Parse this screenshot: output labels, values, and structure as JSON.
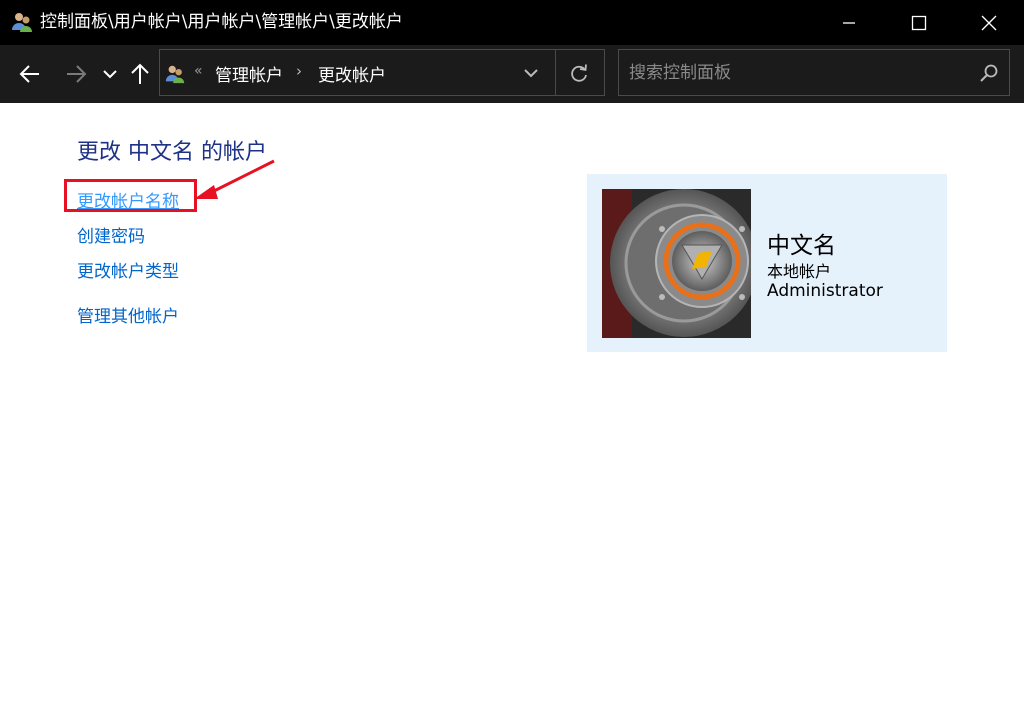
{
  "window": {
    "title": "控制面板\\用户帐户\\用户帐户\\管理帐户\\更改帐户",
    "controls": [
      "minimize-icon",
      "maximize-icon",
      "close-icon"
    ]
  },
  "nav": {
    "icons": [
      "back-arrow-icon",
      "forward-arrow-icon",
      "recent-dropdown-icon",
      "up-arrow-icon"
    ]
  },
  "address": {
    "overflow_glyph": "«",
    "breadcrumbs": [
      "管理帐户",
      "更改帐户"
    ],
    "separator": "›"
  },
  "search": {
    "placeholder": "搜索控制面板",
    "value": ""
  },
  "main": {
    "heading": "更改 中文名 的帐户",
    "links": {
      "change_name": "更改帐户名称",
      "create_password": "创建密码",
      "change_type": "更改帐户类型",
      "manage_other": "管理其他帐户"
    }
  },
  "account_card": {
    "name": "中文名",
    "type": "本地帐户",
    "role": "Administrator"
  },
  "colors": {
    "titlebar_bg": "#000000",
    "navbar_bg": "#1b1b1b",
    "heading": "#1e3287",
    "link": "#0066cc",
    "card_bg": "#e5f1fb",
    "annotation": "#e81123"
  }
}
